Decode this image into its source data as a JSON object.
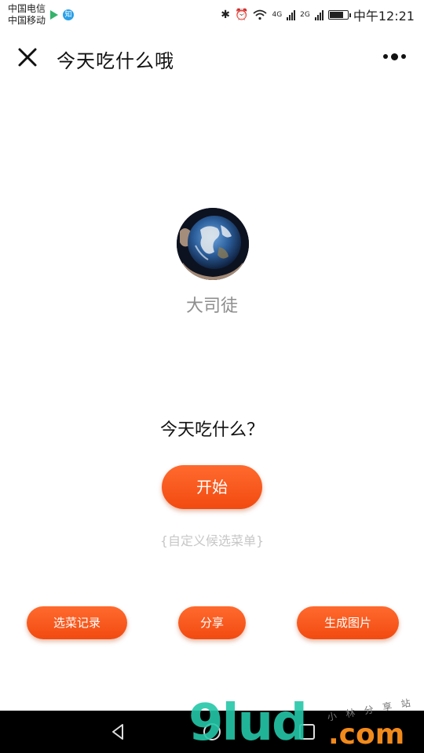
{
  "status_bar": {
    "carrier1": "中国电信",
    "carrier2": "中国移动",
    "app_badge": "知",
    "network1": "4G",
    "network2": "2G",
    "time": "中午12:21",
    "battery_level": 0.85
  },
  "title_bar": {
    "title": "今天吃什么哦"
  },
  "profile": {
    "username": "大司徒"
  },
  "main": {
    "question": "今天吃什么？",
    "start_label": "开始",
    "custom_menu_label": "{自定义候选菜单}"
  },
  "actions": {
    "records_label": "选菜记录",
    "share_label": "分享",
    "image_label": "生成图片"
  },
  "watermark": {
    "main": "9lud",
    "suffix": ".com",
    "side_text": "小 林 分 享 站"
  },
  "colors": {
    "accent": "#f5531a",
    "muted_text": "#8e8e8e",
    "link_text": "#c7c7c7"
  }
}
